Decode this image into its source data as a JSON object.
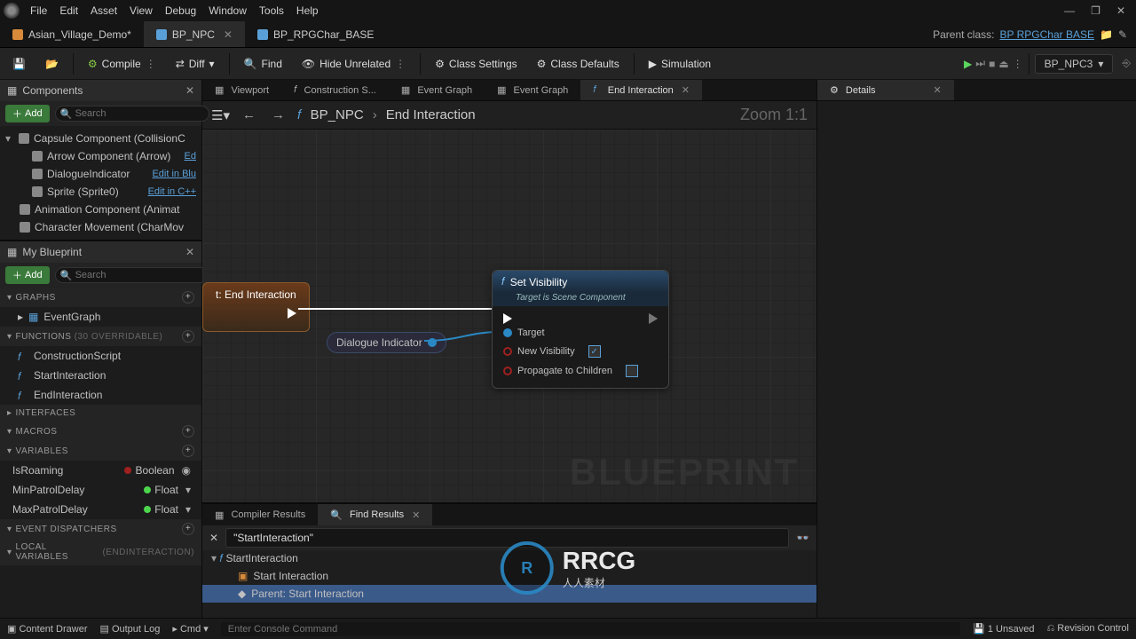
{
  "menu": [
    "File",
    "Edit",
    "Asset",
    "View",
    "Debug",
    "Window",
    "Tools",
    "Help"
  ],
  "win_controls": {
    "min": "—",
    "max": "❐",
    "close": "✕"
  },
  "doc_tabs": [
    {
      "label": "Asian_Village_Demo*",
      "kind": "map"
    },
    {
      "label": "BP_NPC",
      "kind": "bp",
      "active": true,
      "closeable": true
    },
    {
      "label": "BP_RPGChar_BASE",
      "kind": "bp"
    }
  ],
  "parent_class": {
    "label": "Parent class:",
    "value": "BP RPGChar BASE"
  },
  "toolbar": {
    "compile": "Compile",
    "diff": "Diff",
    "find": "Find",
    "hide": "Hide Unrelated",
    "class_settings": "Class Settings",
    "class_defaults": "Class Defaults",
    "simulation": "Simulation",
    "debug_object": "BP_NPC3"
  },
  "left_panels": {
    "components": {
      "title": "Components",
      "add": "Add",
      "search_ph": "Search"
    },
    "tree": [
      {
        "label": "Capsule Component (CollisionC",
        "caret": true,
        "indent": 0
      },
      {
        "label": "Arrow Component (Arrow)",
        "edit": "Ed",
        "indent": 1
      },
      {
        "label": "DialogueIndicator",
        "edit": "Edit in Blu",
        "indent": 1
      },
      {
        "label": "Sprite (Sprite0)",
        "edit": "Edit in C++",
        "indent": 1
      },
      {
        "label": "Animation Component (Animat",
        "indent": 0
      },
      {
        "label": "Character Movement (CharMov",
        "indent": 0
      }
    ],
    "myblueprint": {
      "title": "My Blueprint",
      "add": "Add",
      "search_ph": "Search"
    },
    "sections": {
      "graphs": {
        "label": "GRAPHS",
        "items": [
          "EventGraph"
        ]
      },
      "functions": {
        "label": "FUNCTIONS",
        "note": "(30 OVERRIDABLE)",
        "items": [
          "ConstructionScript",
          "StartInteraction",
          "EndInteraction"
        ]
      },
      "interfaces": {
        "label": "INTERFACES"
      },
      "macros": {
        "label": "MACROS"
      },
      "variables": {
        "label": "VARIABLES",
        "items": [
          {
            "name": "IsRoaming",
            "type": "Boolean",
            "color": "bool",
            "eye": true
          },
          {
            "name": "MinPatrolDelay",
            "type": "Float",
            "color": "float"
          },
          {
            "name": "MaxPatrolDelay",
            "type": "Float",
            "color": "float"
          }
        ]
      },
      "event_dispatchers": {
        "label": "EVENT DISPATCHERS"
      },
      "local_vars": {
        "label": "LOCAL VARIABLES",
        "note": "(ENDINTERACTION)"
      }
    }
  },
  "center_tabs": [
    {
      "label": "Viewport",
      "icon": "viewport"
    },
    {
      "label": "Construction S...",
      "icon": "fx"
    },
    {
      "label": "Event Graph",
      "icon": "graph"
    },
    {
      "label": "Event Graph",
      "icon": "graph"
    },
    {
      "label": "End Interaction",
      "icon": "fx",
      "active": true,
      "close": true
    }
  ],
  "breadcrumb": {
    "nav_back": "←",
    "nav_fwd": "→",
    "root": "BP_NPC",
    "leaf": "End Interaction",
    "zoom": "Zoom 1:1"
  },
  "graph": {
    "watermark": "BLUEPRINT",
    "event_node": {
      "title": "t: End Interaction"
    },
    "var_node": {
      "label": "Dialogue Indicator"
    },
    "set_vis": {
      "title": "Set Visibility",
      "subtitle": "Target is Scene Component",
      "pins": {
        "target": "Target",
        "new_vis": "New Visibility",
        "propagate": "Propagate to Children"
      }
    }
  },
  "results": {
    "tabs": {
      "compiler": "Compiler Results",
      "find": "Find Results"
    },
    "query": "\"StartInteraction\"",
    "rows": [
      {
        "label": "StartInteraction",
        "icon": "fx"
      },
      {
        "label": "Start Interaction",
        "icon": "node",
        "indent": true
      },
      {
        "label": "Parent: Start Interaction",
        "icon": "parent",
        "indent": true,
        "sel": true
      }
    ],
    "binoc": "🔍"
  },
  "details": {
    "title": "Details"
  },
  "bottom": {
    "content_drawer": "Content Drawer",
    "output_log": "Output Log",
    "cmd": "Cmd",
    "console_ph": "Enter Console Command",
    "unsaved": "1 Unsaved",
    "revision": "Revision Control"
  },
  "overlay": {
    "brand": "RRCG",
    "sub": "人人素材"
  }
}
